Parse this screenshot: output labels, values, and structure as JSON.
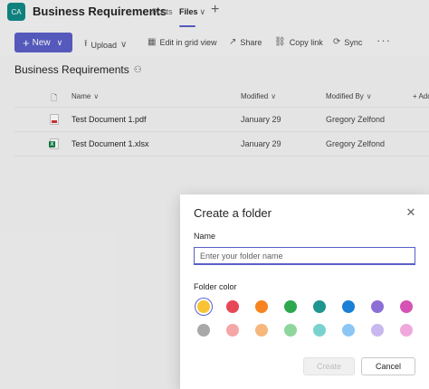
{
  "colors": {
    "accent": "#5b5fc7",
    "team_avatar": "#0f8a86"
  },
  "header": {
    "avatar_initials": "CA",
    "team_name": "Business Requirements",
    "tabs": [
      {
        "label": "Posts"
      },
      {
        "label": "Files",
        "active": true
      }
    ],
    "files_chevron": "∨",
    "add_tab": "+"
  },
  "toolbar": {
    "new_label": "New",
    "upload_label": "Upload",
    "grid_label": "Edit in grid view",
    "share_label": "Share",
    "copy_link_label": "Copy link",
    "sync_label": "Sync",
    "more_label": "···"
  },
  "library": {
    "title": "Business Requirements",
    "columns": {
      "name": "Name",
      "modified": "Modified",
      "modified_by": "Modified By",
      "add_column": "+ Add"
    },
    "files": [
      {
        "name": "Test Document 1.pdf",
        "type": "pdf",
        "modified": "January 29",
        "modified_by": "Gregory Zelfond"
      },
      {
        "name": "Test Document 1.xlsx",
        "type": "xlsx",
        "modified": "January 29",
        "modified_by": "Gregory Zelfond"
      }
    ]
  },
  "dialog": {
    "title": "Create a folder",
    "name_label": "Name",
    "name_placeholder": "Enter your folder name",
    "color_label": "Folder color",
    "create_label": "Create",
    "cancel_label": "Cancel",
    "selected_color": "yellow",
    "colors_row1": [
      {
        "name": "yellow",
        "hex": "#f8c433"
      },
      {
        "name": "red",
        "hex": "#e74856"
      },
      {
        "name": "orange",
        "hex": "#f7841e"
      },
      {
        "name": "green",
        "hex": "#2da84f"
      },
      {
        "name": "teal",
        "hex": "#1f958f"
      },
      {
        "name": "blue",
        "hex": "#1a7fd6"
      },
      {
        "name": "purple",
        "hex": "#8c6fd6"
      },
      {
        "name": "pink",
        "hex": "#d652b4"
      }
    ],
    "colors_row2": [
      {
        "name": "gray",
        "hex": "#a8a8a8"
      },
      {
        "name": "light-red",
        "hex": "#f5a6a6"
      },
      {
        "name": "light-orange",
        "hex": "#f7b77a"
      },
      {
        "name": "light-green",
        "hex": "#8ed69b"
      },
      {
        "name": "light-teal",
        "hex": "#7ad2cf"
      },
      {
        "name": "light-blue",
        "hex": "#8cc6f4"
      },
      {
        "name": "light-purple",
        "hex": "#c9b7ef"
      },
      {
        "name": "light-pink",
        "hex": "#f0a8dc"
      }
    ]
  }
}
